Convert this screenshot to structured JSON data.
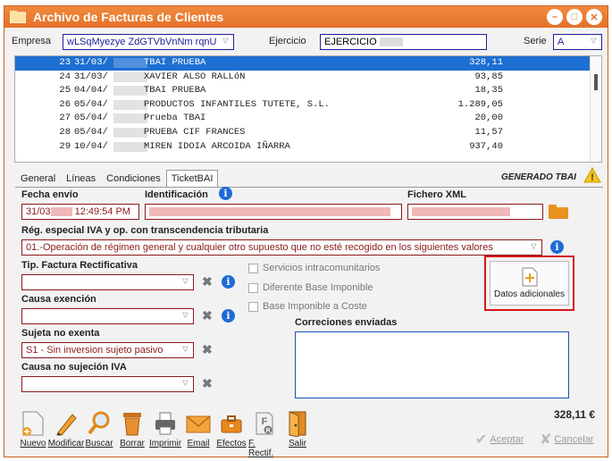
{
  "window": {
    "title": "Archivo de Facturas de Clientes"
  },
  "filters": {
    "empresa_label": "Empresa",
    "empresa_value": "wLSqMyezye ZdGTVbVnNm rqnU",
    "ejercicio_label": "Ejercicio",
    "ejercicio_value": "EJERCICIO",
    "serie_label": "Serie",
    "serie_value": "A"
  },
  "invoices": [
    {
      "no": "23",
      "date": "31/03/",
      "name": "TBAI PRUEBA",
      "amount": "328,11",
      "selected": true
    },
    {
      "no": "24",
      "date": "31/03/",
      "name": "XAVIER ALSO RALLóN",
      "amount": "93,85"
    },
    {
      "no": "25",
      "date": "04/04/",
      "name": "TBAI PRUEBA",
      "amount": "18,35"
    },
    {
      "no": "26",
      "date": "05/04/",
      "name": "PRODUCTOS INFANTILES TUTETE, S.L.",
      "amount": "1.289,05"
    },
    {
      "no": "27",
      "date": "05/04/",
      "name": "Prueba TBAI",
      "amount": "20,00"
    },
    {
      "no": "28",
      "date": "05/04/",
      "name": "PRUEBA CIF FRANCES",
      "amount": "11,57"
    },
    {
      "no": "29",
      "date": "10/04/",
      "name": "MIREN IDOIA ARCOIDA IÑARRA",
      "amount": "937,40"
    }
  ],
  "tabs": [
    "General",
    "Líneas",
    "Condiciones",
    "TicketBAI"
  ],
  "status": {
    "text": "GENERADO TBAI"
  },
  "ticketbai": {
    "fecha_envio_label": "Fecha envío",
    "fecha_envio_date": "31/03",
    "fecha_envio_time": "12:49:54 PM",
    "identificacion_label": "Identificación",
    "fichero_xml_label": "Fichero XML",
    "reg_especial_label": "Rég. especial IVA y op. con transcendencia tributaria",
    "reg_especial_value": "01.-Operación de régimen general y cualquier otro supuesto que no esté recogido en los siguientes valores",
    "tipo_rectificativa_label": "Tip. Factura Rectificativa",
    "causa_exencion_label": "Causa exención",
    "sujeta_no_exenta_label": "Sujeta no exenta",
    "sujeta_no_exenta_value": "S1 - Sin inversion sujeto pasivo",
    "causa_no_sujecion_label": "Causa no sujeción IVA",
    "chk_intracomunitarios": "Servicios intracomunitarios",
    "chk_diferente_base": "Diferente Base Imponible",
    "chk_base_coste": "Base Imponible a Coste",
    "correcciones_label": "Correciones enviadas",
    "datos_adicionales_label": "Datos adicionales"
  },
  "toolbar": [
    "Nuevo",
    "Modificar",
    "Buscar",
    "Borrar",
    "Imprimir",
    "Email",
    "Efectos",
    "F. Rectif.",
    "Salir"
  ],
  "total": "328,11 €",
  "actions": {
    "accept": "Aceptar",
    "cancel": "Cancelar"
  }
}
